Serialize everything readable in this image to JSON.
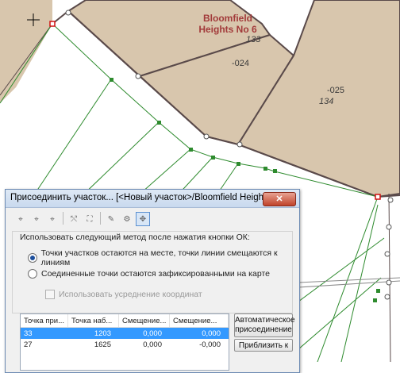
{
  "map": {
    "parcel_title_line1": "Bloomfield",
    "parcel_title_line2": "Heights No 6",
    "labels": [
      "133",
      "-024",
      "-025",
      "134"
    ],
    "cursor": "crosshair"
  },
  "dialog": {
    "title": "Присоединить участок... [<Новый участок>/Bloomfield Heights No4...",
    "close_icon": "close-icon",
    "toolbar_icons": [
      "attach-point-icon",
      "attach-point-2-icon",
      "attach-point-3-icon",
      "attach-line-icon",
      "zoom-extent-icon",
      "edit-icon",
      "settings-icon",
      "move-parcel-icon"
    ],
    "method_label": "Использовать следующий метод после нажатия кнопки ОК:",
    "radio_1": "Точки участков остаются на месте, точки линии смещаются к линиям",
    "radio_2": "Соединенные точки остаются зафиксированными на карте",
    "checkbox_label": "Использовать усреднение координат",
    "table": {
      "headers": [
        "Точка при...",
        "Точка наб...",
        "Смещение...",
        "Смещение..."
      ],
      "rows": [
        {
          "c1": "33",
          "c2": "1203",
          "c3": "0,000",
          "c4": "0,000",
          "selected": true
        },
        {
          "c1": "27",
          "c2": "1625",
          "c3": "0,000",
          "c4": "-0,000",
          "selected": false
        }
      ]
    },
    "auto_button": "Автоматическое присоединение",
    "zoom_button": "Приблизить к"
  }
}
